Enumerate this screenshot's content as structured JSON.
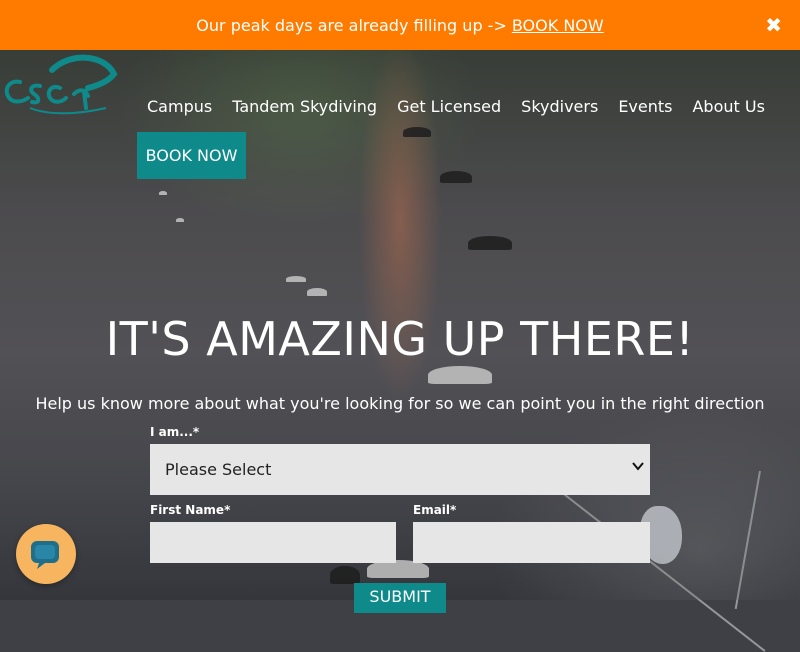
{
  "announcement": {
    "text": "Our peak days are already filling up ->",
    "link": "BOOK NOW",
    "close_icon": "close-icon"
  },
  "nav": {
    "items": [
      "Campus",
      "Tandem Skydiving",
      "Get Licensed",
      "Skydivers",
      "Events",
      "About Us"
    ],
    "book_label": "BOOK NOW"
  },
  "hero": {
    "title": "IT'S AMAZING UP THERE!",
    "subtitle": "Help us know more about what you're looking for so we can point you in the right direction"
  },
  "form": {
    "iam_label": "I am...",
    "required_mark": "*",
    "iam_value": "Please Select",
    "first_name_label": "First Name",
    "email_label": "Email",
    "submit_label": "SUBMIT"
  },
  "colors": {
    "announce_bg": "#ff7b00",
    "brand_teal": "#0e8a8b",
    "chat_bg": "#f7b55f"
  },
  "icons": {
    "logo": "parachute-logo",
    "chat": "chat-icon",
    "dropdown": "chevron-down-icon"
  }
}
